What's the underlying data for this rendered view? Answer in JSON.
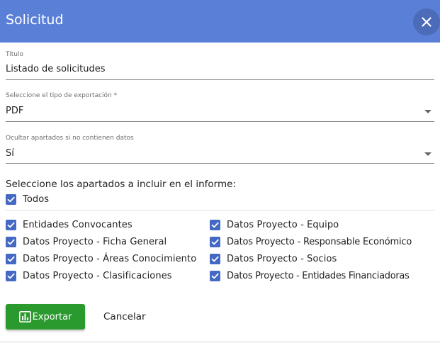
{
  "header": {
    "title": "Solicitud",
    "close_icon": "close-icon"
  },
  "colors": {
    "header_bg": "#5a7fd6",
    "checkbox": "#4469c4",
    "primary_button": "#2b9a2e"
  },
  "form": {
    "titulo": {
      "label": "Titulo",
      "value": "Listado de solicitudes"
    },
    "tipo_exportacion": {
      "label": "Seleccione el tipo de exportación *",
      "value": "PDF"
    },
    "ocultar_apartados": {
      "label": "Ocultar apartados si no contienen datos",
      "value": "Sí"
    }
  },
  "sections": {
    "title": "Seleccione los apartados a incluir en el informe:",
    "todos": {
      "label": "Todos",
      "checked": true
    },
    "left": [
      {
        "label": "Entidades Convocantes",
        "checked": true
      },
      {
        "label": "Datos Proyecto - Ficha General",
        "checked": true
      },
      {
        "label": "Datos Proyecto - Áreas Conocimiento",
        "checked": true
      },
      {
        "label": "Datos Proyecto - Clasificaciones",
        "checked": true
      }
    ],
    "right": [
      {
        "label": "Datos Proyecto - Equipo",
        "checked": true
      },
      {
        "label": "Datos Proyecto - Responsable Económico",
        "checked": true
      },
      {
        "label": "Datos Proyecto - Socios",
        "checked": true
      },
      {
        "label": "Datos Proyecto - Entidades Financiadoras",
        "checked": true
      }
    ]
  },
  "actions": {
    "export_label": "Exportar",
    "export_icon": "bar-chart-icon",
    "cancel_label": "Cancelar"
  }
}
